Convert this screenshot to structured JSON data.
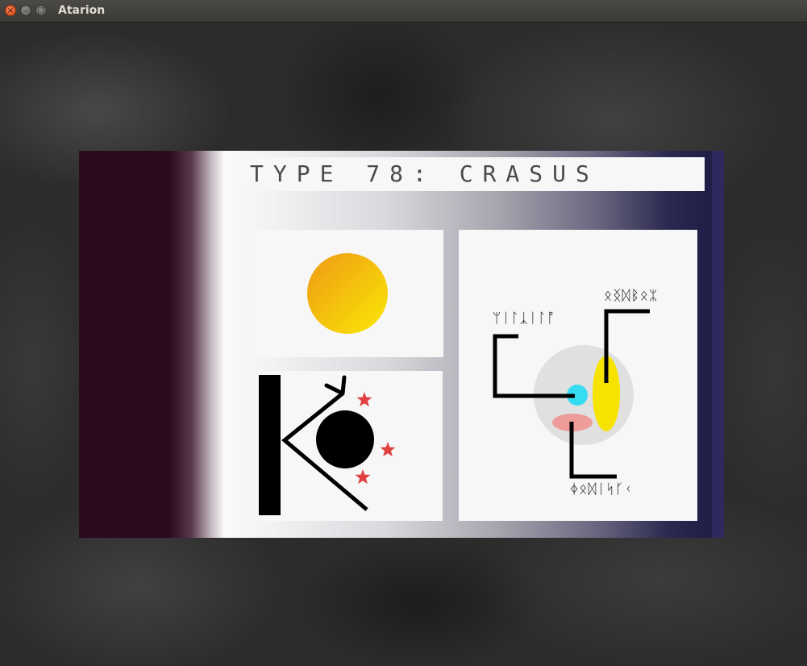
{
  "window": {
    "title": "Atarion",
    "close_glyph": "×",
    "minimize_glyph": "–",
    "maximize_glyph": "□"
  },
  "card": {
    "title": "TYPE 78: CRASUS"
  },
  "diagram": {
    "label_top": "ᛟᛝᛞᛒᛟᛯ",
    "label_left": "ᛘᛁᛚᛣᛁᛚᚩ",
    "label_bottom": "ᛄᛟᛞᛁᛋᚴᚲ"
  },
  "colors": {
    "sun_light": "#fbe804",
    "sun_dark": "#ee9a16",
    "star": "#e04040",
    "moon_yellow": "#f6e300",
    "moon_cyan": "#35dcf2",
    "moon_pink": "#ed9c9a",
    "planet_gray": "#e0e0e0",
    "card_left": "#2b0a1f",
    "card_right": "#2e2a5e"
  },
  "icons": {
    "sun": "sun-icon",
    "sigil": "arrow-orbit-sigil-icon",
    "system": "planet-system-diagram"
  }
}
